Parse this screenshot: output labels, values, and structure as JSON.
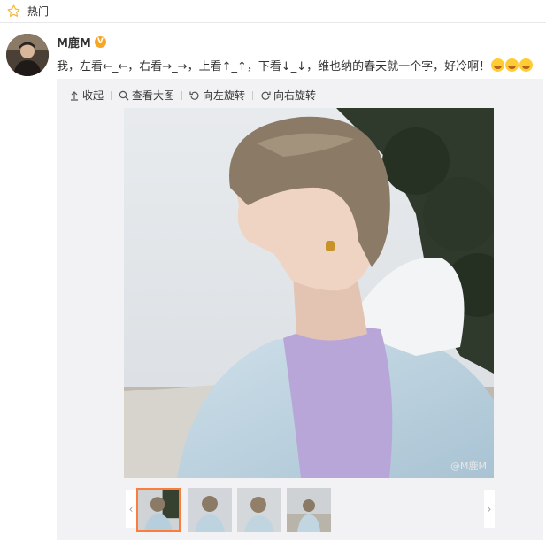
{
  "topbar": {
    "label": "热门"
  },
  "post": {
    "username": "M鹿M",
    "verified_badge": "V",
    "text": "我，左看←_←，右看→_→，上看↑_↑，下看↓_↓，维也纳的春天就一个字，好冷啊！",
    "emojis": [
      "laugh-cry",
      "laugh-cry",
      "laugh-cry"
    ]
  },
  "toolbar": {
    "collapse": "收起",
    "view_large": "查看大图",
    "rotate_left": "向左旋转",
    "rotate_right": "向右旋转"
  },
  "photo": {
    "watermark": "@M鹿M"
  },
  "thumbnails": {
    "count": 4,
    "selected_index": 0
  },
  "colors": {
    "accent": "#fa7d3c",
    "badge": "#f6a623",
    "star": "#f7b733"
  }
}
